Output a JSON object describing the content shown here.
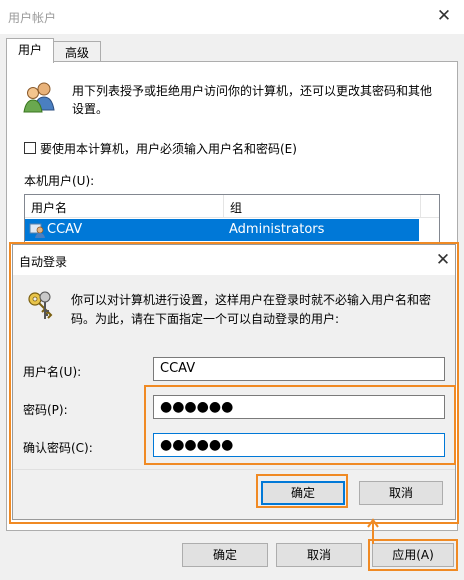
{
  "window": {
    "title": "用户帐户",
    "tabs": [
      {
        "label": "用户",
        "active": true
      },
      {
        "label": "高级",
        "active": false
      }
    ]
  },
  "main": {
    "description": [
      "用下列表授予或拒绝用户访问你的计算机，还可以更改其密码和其他",
      "设置。"
    ],
    "require_password_label": "要使用本计算机，用户必须输入用户名和密码(E)",
    "require_password_checked": false,
    "local_users_label": "本机用户(U):",
    "table": {
      "columns": [
        "用户名",
        "组"
      ],
      "rows": [
        {
          "name": "CCAV",
          "group": "Administrators",
          "selected": true
        }
      ]
    }
  },
  "buttons": {
    "ok": "确定",
    "cancel": "取消",
    "apply": "应用(A)"
  },
  "dialog": {
    "title": "自动登录",
    "description": [
      "你可以对计算机进行设置，这样用户在登录时就不必输入用户名和密",
      "码。为此，请在下面指定一个可以自动登录的用户:"
    ],
    "fields": {
      "username": {
        "label": "用户名(U):",
        "value": "CCAV"
      },
      "password": {
        "label": "密码(P):",
        "value": "●●●●●●"
      },
      "confirm": {
        "label": "确认密码(C):",
        "value": "●●●●●●"
      }
    },
    "ok_label": "确定",
    "cancel_label": "取消"
  },
  "colors": {
    "accent": "#0078d7",
    "highlight": "#f08a24"
  },
  "icons": [
    "close-icon",
    "users-icon",
    "keys-icon",
    "user-icon",
    "arrow-up-icon"
  ]
}
